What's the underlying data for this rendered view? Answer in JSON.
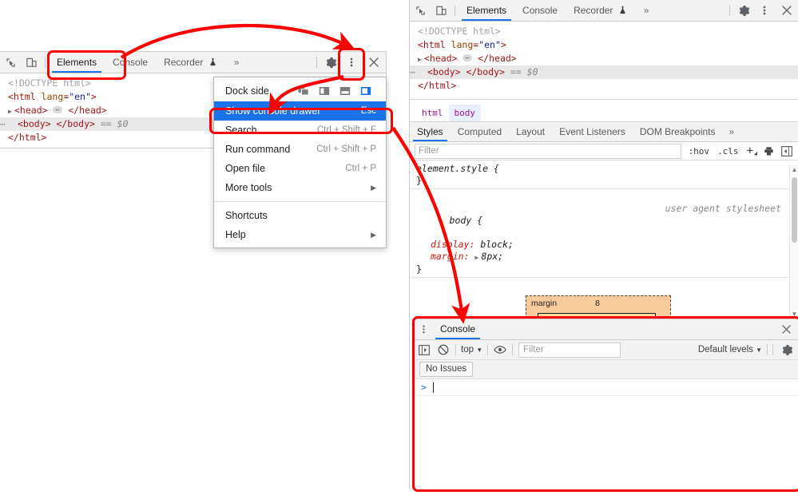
{
  "left_panel": {
    "toolbar": {
      "inspect_icon": "inspect-cursor-icon",
      "device_icon": "device-toolbar-icon",
      "tabs": [
        {
          "label": "Elements",
          "active": true
        },
        {
          "label": "Console",
          "active": false
        },
        {
          "label": "Recorder",
          "active": false,
          "badge": "flask-icon"
        }
      ],
      "overflow_label": "»",
      "settings_icon": "gear-icon",
      "more_icon": "kebab-menu-icon",
      "close_icon": "close-icon"
    },
    "dom_tree": {
      "doctype": "<!DOCTYPE html>",
      "html_open_tag": "<html",
      "html_attr_name": "lang",
      "html_attr_value": "\"en\"",
      "head_line": "<head> … </head>",
      "body_line": "<body> </body>",
      "body_marker": "== $0",
      "html_close_tag": "</html>"
    }
  },
  "context_menu": {
    "dock_side_label": "Dock side",
    "dock_options": [
      "undock-into-separate-window",
      "dock-to-left",
      "dock-to-bottom",
      "dock-to-right"
    ],
    "dock_selected_index": 3,
    "items": [
      {
        "label": "Show console drawer",
        "shortcut": "Esc",
        "highlighted": true
      },
      {
        "label": "Search",
        "shortcut": "Ctrl + Shift + F",
        "highlighted": false
      },
      {
        "label": "Run command",
        "shortcut": "Ctrl + Shift + P",
        "highlighted": false
      },
      {
        "label": "Open file",
        "shortcut": "Ctrl + P",
        "highlighted": false
      },
      {
        "label": "More tools",
        "shortcut": "",
        "submenu": true,
        "highlighted": false
      }
    ],
    "items2": [
      {
        "label": "Shortcuts",
        "shortcut": "",
        "highlighted": false
      },
      {
        "label": "Help",
        "shortcut": "",
        "submenu": true,
        "highlighted": false
      }
    ]
  },
  "right_panel": {
    "toolbar": {
      "tabs": [
        {
          "label": "Elements",
          "active": true
        },
        {
          "label": "Console",
          "active": false
        },
        {
          "label": "Recorder",
          "active": false,
          "badge": "flask-icon"
        }
      ],
      "overflow_label": "»",
      "settings_icon": "gear-icon",
      "more_icon": "kebab-menu-icon",
      "close_icon": "close-icon"
    },
    "dom_tree": {
      "doctype": "<!DOCTYPE html>",
      "html_open_tag": "<html",
      "html_attr_name": "lang",
      "html_attr_value": "\"en\"",
      "head_line": "<head> … </head>",
      "body_line": "<body> </body>",
      "body_marker": "== $0",
      "html_close_tag": "</html>"
    },
    "breadcrumb": [
      "html",
      "body"
    ],
    "breadcrumb_selected": "body",
    "styles_tabs": [
      {
        "label": "Styles",
        "active": true
      },
      {
        "label": "Computed",
        "active": false
      },
      {
        "label": "Layout",
        "active": false
      },
      {
        "label": "Event Listeners",
        "active": false
      },
      {
        "label": "DOM Breakpoints",
        "active": false
      }
    ],
    "styles_overflow": "»",
    "filter_placeholder": "Filter",
    "filter_tools": [
      ":hov",
      ".cls"
    ],
    "new_rule_icon": "plus-icon",
    "print_media_icon": "print-preview-icon",
    "sidebar_toggle_icon": "toggle-sidebar-icon",
    "css_rules": [
      {
        "selector": "element.style {",
        "origin": "",
        "declarations": [],
        "close": "}"
      },
      {
        "selector": "body {",
        "origin": "user agent stylesheet",
        "declarations": [
          {
            "prop": "display:",
            "value": "block;"
          },
          {
            "prop": "margin:",
            "value": "8px;",
            "expandable": true
          }
        ],
        "close": "}"
      }
    ],
    "box_model": {
      "margin_label": "margin",
      "margin_value": "8"
    }
  },
  "console_drawer": {
    "more_icon": "kebab-menu-icon",
    "tab_label": "Console",
    "close_icon": "close-icon",
    "toolbar": {
      "sidebar_icon": "console-sidebar-icon",
      "clear_icon": "clear-console-icon",
      "context_label": "top",
      "context_caret": "▼",
      "eye_icon": "live-expression-icon",
      "filter_placeholder": "Filter",
      "levels_label": "Default levels",
      "levels_caret": "▼",
      "settings_icon": "gear-icon"
    },
    "issues_label": "No Issues",
    "prompt_symbol": ">"
  },
  "annotations": {
    "color": "#ff0000",
    "boxes": [
      {
        "name": "elements-tab-highlight"
      },
      {
        "name": "more-menu-highlight"
      },
      {
        "name": "show-console-drawer-highlight"
      },
      {
        "name": "console-drawer-highlight"
      }
    ],
    "arrows": [
      {
        "name": "arrow-elements-to-more-menu"
      },
      {
        "name": "arrow-more-menu-to-show-console-drawer"
      },
      {
        "name": "arrow-menu-to-console-drawer"
      }
    ]
  }
}
